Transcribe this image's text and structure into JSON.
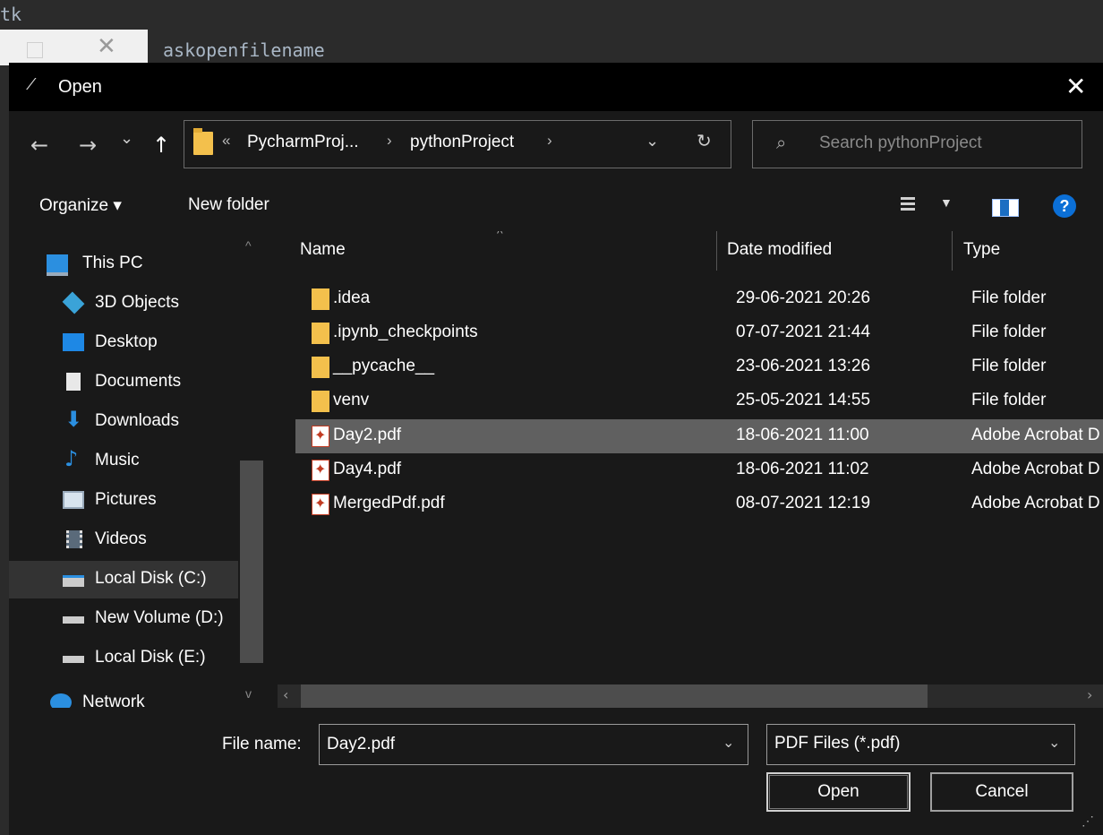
{
  "background": {
    "code_fragment": "tk",
    "code_text": "askopenfilename"
  },
  "dialog": {
    "title": "Open",
    "close_glyph": "✕"
  },
  "navigation": {
    "back": "←",
    "forward": "→",
    "recent": "⌄",
    "up": "↑",
    "breadcrumb_overflow": "«",
    "breadcrumbs": [
      "PycharmProj...",
      "pythonProject"
    ],
    "separator": "›",
    "dropdown": "⌄",
    "refresh": "↻"
  },
  "search": {
    "placeholder": "Search pythonProject",
    "icon": "⌕"
  },
  "commandbar": {
    "organize": "Organize ▾",
    "new_folder": "New folder",
    "view_dropdown": "▼",
    "help": "?"
  },
  "sidebar": {
    "items": [
      {
        "label": "This PC",
        "icon": "computer-icon"
      },
      {
        "label": "3D Objects",
        "icon": "cube-icon"
      },
      {
        "label": "Desktop",
        "icon": "desktop-icon"
      },
      {
        "label": "Documents",
        "icon": "document-icon"
      },
      {
        "label": "Downloads",
        "icon": "download-icon"
      },
      {
        "label": "Music",
        "icon": "music-icon"
      },
      {
        "label": "Pictures",
        "icon": "picture-icon"
      },
      {
        "label": "Videos",
        "icon": "video-icon"
      },
      {
        "label": "Local Disk (C:)",
        "icon": "drive-icon",
        "selected": true
      },
      {
        "label": "New Volume (D:)",
        "icon": "drive-icon"
      },
      {
        "label": "Local Disk (E:)",
        "icon": "drive-icon"
      },
      {
        "label": "Network",
        "icon": "network-icon"
      }
    ]
  },
  "file_list": {
    "columns": [
      "Name",
      "Date modified",
      "Type"
    ],
    "rows": [
      {
        "name": ".idea",
        "date": "29-06-2021 20:26",
        "type": "File folder",
        "kind": "folder"
      },
      {
        "name": ".ipynb_checkpoints",
        "date": "07-07-2021 21:44",
        "type": "File folder",
        "kind": "folder"
      },
      {
        "name": "__pycache__",
        "date": "23-06-2021 13:26",
        "type": "File folder",
        "kind": "folder"
      },
      {
        "name": "venv",
        "date": "25-05-2021 14:55",
        "type": "File folder",
        "kind": "folder"
      },
      {
        "name": "Day2.pdf",
        "date": "18-06-2021 11:00",
        "type": "Adobe Acrobat D",
        "kind": "pdf",
        "selected": true
      },
      {
        "name": "Day4.pdf",
        "date": "18-06-2021 11:02",
        "type": "Adobe Acrobat D",
        "kind": "pdf"
      },
      {
        "name": "MergedPdf.pdf",
        "date": "08-07-2021 12:19",
        "type": "Adobe Acrobat D",
        "kind": "pdf"
      }
    ]
  },
  "bottom": {
    "file_name_label": "File name:",
    "file_name_value": "Day2.pdf",
    "file_type_value": "PDF Files (*.pdf)",
    "open_button": "Open",
    "cancel_button": "Cancel"
  },
  "colors": {
    "dialog_bg": "#191919",
    "titlebar_bg": "#000000",
    "selected_row": "#606060",
    "folder": "#f3c04c",
    "help_blue": "#0b6fd6"
  }
}
